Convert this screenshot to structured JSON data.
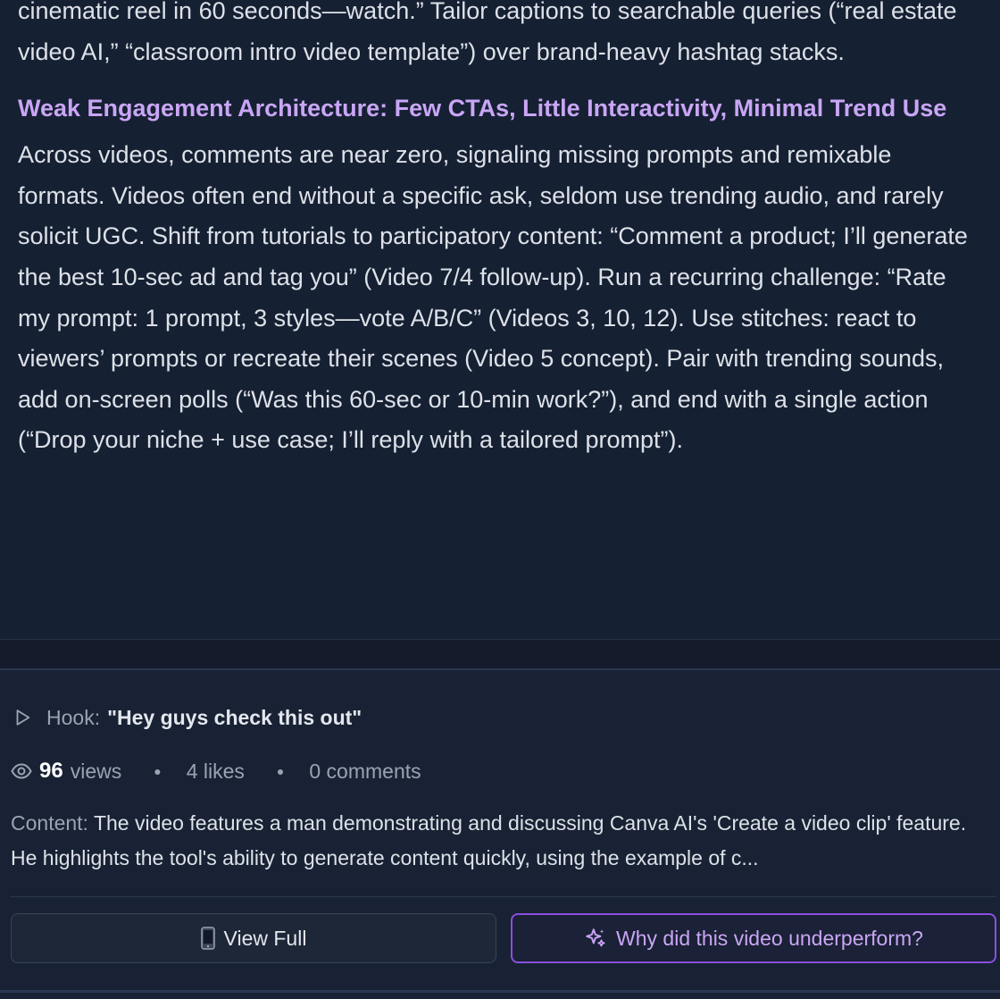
{
  "analysis": {
    "intro_text": "cinematic reel in 60 seconds—watch.” Tailor captions to searchable queries (“real estate video AI,” “classroom intro video template”) over brand-heavy hashtag stacks.",
    "section_title": "Weak Engagement Architecture: Few CTAs, Little Interactivity, Minimal Trend Use",
    "section_body": "Across videos, comments are near zero, signaling missing prompts and remixable formats. Videos often end without a specific ask, seldom use trending audio, and rarely solicit UGC. Shift from tutorials to participatory content: “Comment a product; I’ll generate the best 10-sec ad and tag you” (Video 7/4 follow-up). Run a recurring challenge: “Rate my prompt: 1 prompt, 3 styles—vote A/B/C” (Videos 3, 10, 12). Use stitches: react to viewers’ prompts or recreate their scenes (Video 5 concept). Pair with trending sounds, add on-screen polls (“Was this 60-sec or 10-min work?”), and end with a single action (“Drop your niche + use case; I’ll reply with a tailored prompt”)."
  },
  "video_card": {
    "hook_label": "Hook:",
    "hook_value": "\"Hey guys check this out\"",
    "views_count": "96",
    "views_label": "views",
    "likes": "4 likes",
    "comments": "0 comments",
    "content_label": "Content:",
    "content_text": "The video features a man demonstrating and discussing Canva AI's 'Create a video clip' feature. He highlights the tool's ability to generate content quickly, using the example of c...",
    "view_full_label": "View Full",
    "why_label": "Why did this video underperform?"
  },
  "colors": {
    "background": "#141c2b",
    "accent_purple": "#c9a6f5",
    "accent_border": "#8a4fe0",
    "muted_text": "#9aa3b2"
  },
  "icons": [
    "play-icon",
    "eye-icon",
    "phone-icon",
    "sparkles-icon"
  ]
}
